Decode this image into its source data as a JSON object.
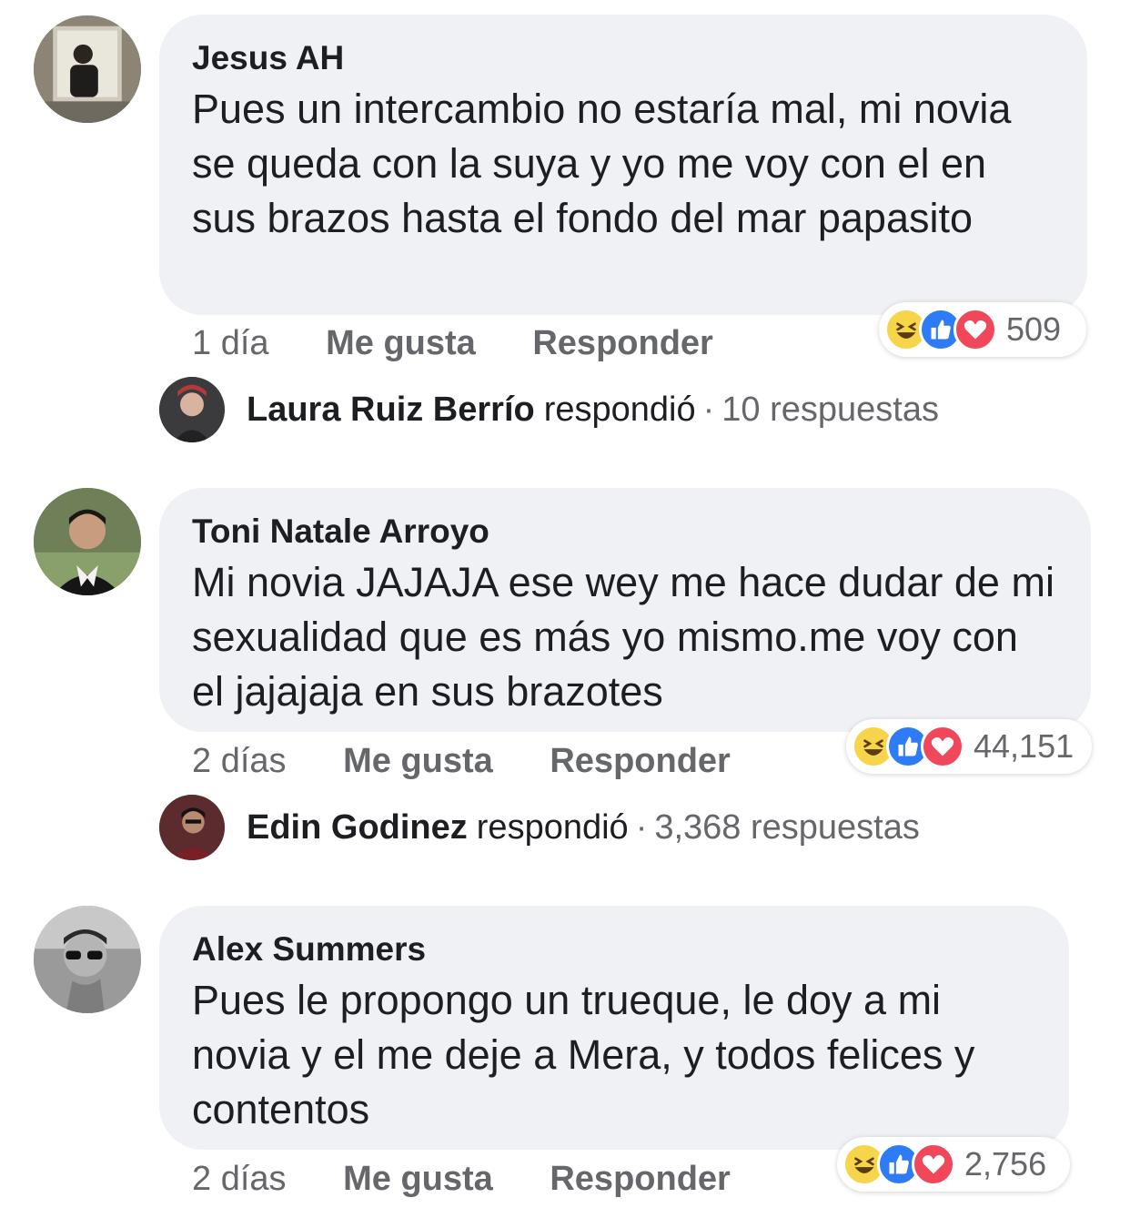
{
  "comments": [
    {
      "author": "Jesus AH",
      "text": "Pues un intercambio no estaría mal, mi novia se queda con la suya y yo me voy con el en sus brazos hasta el fondo del mar papasito",
      "time": "1 día",
      "like_label": "Me gusta",
      "reply_label": "Responder",
      "reaction_count": "509",
      "reactions": [
        "haha-icon",
        "like-icon",
        "love-icon"
      ],
      "reply": {
        "name": "Laura Ruiz Berrío",
        "verb": "respondió",
        "separator": "·",
        "count": "10 respuestas"
      }
    },
    {
      "author": "Toni Natale Arroyo",
      "text": "Mi novia JAJAJA ese wey me hace dudar de mi sexualidad que es más yo mismo.me voy con el jajajaja en sus brazotes",
      "time": "2 días",
      "like_label": "Me gusta",
      "reply_label": "Responder",
      "reaction_count": "44,151",
      "reactions": [
        "haha-icon",
        "like-icon",
        "love-icon"
      ],
      "reply": {
        "name": "Edin Godinez",
        "verb": "respondió",
        "separator": "·",
        "count": "3,368 respuestas"
      }
    },
    {
      "author": "Alex Summers",
      "text": "Pues le propongo un trueque, le doy a mi novia y el me deje a Mera, y todos felices y contentos",
      "time": "2 días",
      "like_label": "Me gusta",
      "reply_label": "Responder",
      "reaction_count": "2,756",
      "reactions": [
        "haha-icon",
        "like-icon",
        "love-icon"
      ]
    }
  ],
  "colors": {
    "bubble": "#f0f1f4",
    "meta_text": "#65676b",
    "like_blue": "#2e7bf6",
    "love_red": "#f0475b",
    "haha_yellow": "#f7d54a"
  }
}
